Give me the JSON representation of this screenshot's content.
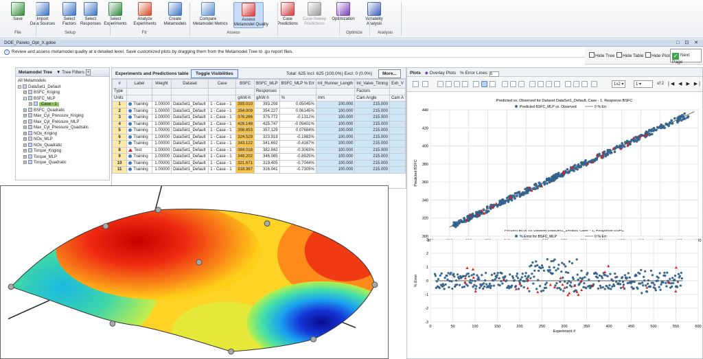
{
  "ribbon": {
    "buttons": [
      {
        "label": "Save",
        "sub": "▾"
      },
      {
        "label": "Import\nData Sources"
      },
      {
        "label": "Select\nFactors"
      },
      {
        "label": "Select\nResponses"
      },
      {
        "label": "Select\nExperiments"
      },
      {
        "label": "Analyze\nExperiments"
      },
      {
        "label": "Create\nMetamodels"
      },
      {
        "label": "Compare\nMetamodel Metrics"
      },
      {
        "label": "Assess\nMetamodel Quality"
      },
      {
        "label": "Case\nPredictions"
      },
      {
        "label": "Case-Sweep\nPredictions"
      },
      {
        "label": "Optimization"
      },
      {
        "label": "Variability\nAnalysis"
      }
    ],
    "groups": [
      "File",
      "Setup",
      "Fit",
      "Assess",
      "Optimize",
      "Analysis"
    ]
  },
  "document_tab": {
    "title": "DOE_Pareto_Opt_X.gdoe",
    "window_buttons": "□ ⊡ ✕"
  },
  "info": {
    "text": "Review and assess metamodel quality at a detailed level. Save customized plots by dragging them from the Metamodel Tree to .gu report files."
  },
  "hide": {
    "tree": "Hide Tree",
    "table": "Hide Table",
    "plots": "Hide Plots",
    "next": "Next Page"
  },
  "tree": {
    "title": "Metamodel Tree",
    "filters": "Tree Filters",
    "items": [
      {
        "label": "All Metamodels",
        "level": 0
      },
      {
        "label": "DataSet1_Default",
        "level": 0
      },
      {
        "label": "BSFC_Kriging",
        "level": 1
      },
      {
        "label": "BSFC_MLP",
        "level": 1
      },
      {
        "label": "Case - 1",
        "level": 2
      },
      {
        "label": "BSFC_Quadratic",
        "level": 1
      },
      {
        "label": "Max_Cyl_Pressure_Kriging",
        "level": 1
      },
      {
        "label": "Max_Cyl_Pressure_MLP",
        "level": 1
      },
      {
        "label": "Max_Cyl_Pressure_Quadratic",
        "level": 1
      },
      {
        "label": "NOx_Kriging",
        "level": 1
      },
      {
        "label": "NOx_MLP",
        "level": 1
      },
      {
        "label": "NOx_Quadratic",
        "level": 1
      },
      {
        "label": "Torque_Kriging",
        "level": 1
      },
      {
        "label": "Torque_MLP",
        "level": 1
      },
      {
        "label": "Torque_Quadratic",
        "level": 1
      }
    ]
  },
  "table": {
    "title": "Experiments and Predictions table",
    "toggle": "Toggle Visibilities",
    "total": "Total: 625  Incl: 625 (100.0%)  Excl: 0 (0.0%)",
    "more": "More...",
    "headers": [
      "#",
      "Label",
      "Weight",
      "Dataset",
      "Case",
      "BSFC",
      "BSFC_MLP",
      "BSFC_MLP % Err",
      "Int_Runner_Length",
      "Int_Valve_Timing",
      "Exh_V"
    ],
    "type_row": [
      "Type",
      "",
      "",
      "",
      "",
      "",
      "Responses",
      "",
      "",
      "Factors",
      ""
    ],
    "units_row": [
      "Units",
      "",
      "",
      "",
      "",
      "g/kW-h",
      "g/kW-h",
      "%",
      "mm",
      "Cam Angle",
      "Cam A"
    ],
    "rows": [
      [
        "1",
        "Training",
        "1.00000",
        "DataSet1_Default",
        "1 - Case - 1",
        "393.010",
        "393.208",
        "0.05045%",
        "100.000",
        "215.000"
      ],
      [
        "2",
        "Training",
        "1.00000",
        "DataSet1_Default",
        "1 - Case - 1",
        "354.009",
        "354.227",
        "0.06145%",
        "100.000",
        "215.000"
      ],
      [
        "3",
        "Training",
        "1.00000",
        "DataSet1_Default",
        "1 - Case - 1",
        "376.266",
        "375.772",
        "-0.1312%",
        "100.000",
        "215.000"
      ],
      [
        "4",
        "Training",
        "1.00000",
        "DataSet1_Default",
        "1 - Case - 1",
        "426.148",
        "425.747",
        "-0.09401%",
        "100.000",
        "215.000"
      ],
      [
        "5",
        "Training",
        "1.00000",
        "DataSet1_Default",
        "1 - Case - 1",
        "356.853",
        "357.129",
        "0.07684%",
        "100.000",
        "215.000"
      ],
      [
        "6",
        "Training",
        "1.00000",
        "DataSet1_Default",
        "1 - Case - 1",
        "324.529",
        "323.918",
        "-0.1883%",
        "100.000",
        "215.000"
      ],
      [
        "7",
        "Training",
        "1.00000",
        "DataSet1_Default",
        "1 - Case - 1",
        "343.122",
        "341.692",
        "-0.4167%",
        "100.000",
        "215.000"
      ],
      [
        "8",
        "Test",
        "1.00000",
        "DataSet1_Default",
        "1 - Case - 1",
        "384.018",
        "382.842",
        "-0.3063%",
        "100.000",
        "215.000"
      ],
      [
        "9",
        "Training",
        "1.00000",
        "DataSet1_Default",
        "1 - Case - 1",
        "349.202",
        "346.085",
        "-0.8925%",
        "100.000",
        "215.000"
      ],
      [
        "10",
        "Training",
        "1.00000",
        "DataSet1_Default",
        "1 - Case - 1",
        "321.671",
        "319.405",
        "-0.7044%",
        "100.000",
        "215.000"
      ],
      [
        "11",
        "Training",
        "1.00000",
        "DataSet1_Default",
        "1 - Case - 1",
        "318.367",
        "316.041",
        "-0.7305%",
        "100.000",
        "215.000"
      ]
    ]
  },
  "plots": {
    "title": "Plots",
    "overlay": "Overlay Plots",
    "error_lines_label": "% Error Lines:",
    "error_lines_value": "0",
    "layout": "1x2",
    "page": "1",
    "of": "of 2"
  },
  "chart_data": [
    {
      "type": "scatter",
      "title": "Predicted vs. Observed for Dataset DataSet1_Default, Case - 1, Response BSFC",
      "legend": [
        "Predicted BSFC_MLP vs. Observed",
        "0 % Err"
      ],
      "xlabel": "Observed BSFC",
      "ylabel": "Predicted BSFC",
      "xlim": [
        300,
        440
      ],
      "ylim": [
        300,
        440
      ],
      "xticks": [
        300,
        310,
        320,
        330,
        340,
        350,
        360,
        370,
        380,
        390,
        400,
        410,
        420,
        430,
        440
      ],
      "yticks": [
        300,
        320,
        340,
        360,
        380,
        400,
        420,
        440
      ]
    },
    {
      "type": "scatter",
      "title": "Percent Error for Dataset DataSet1_Default, Case - 1, Response BSFC",
      "legend": [
        "% Error for BSFC_MLP",
        "0 % Err"
      ],
      "xlabel": "Experiment #",
      "ylabel": "% Error",
      "xlim": [
        0,
        600
      ],
      "ylim": [
        -3,
        3
      ],
      "xticks": [
        0,
        50,
        100,
        150,
        200,
        250,
        300,
        350,
        400,
        450,
        500,
        550,
        600
      ],
      "yticks": [
        -3,
        -2,
        -1,
        0,
        1,
        2,
        3
      ]
    }
  ],
  "colors": {
    "training": "#3b78c8",
    "test": "#d62020",
    "accent": "#4f82c8",
    "bsfc": "#f6c34c",
    "factor": "#cfe6f5"
  }
}
